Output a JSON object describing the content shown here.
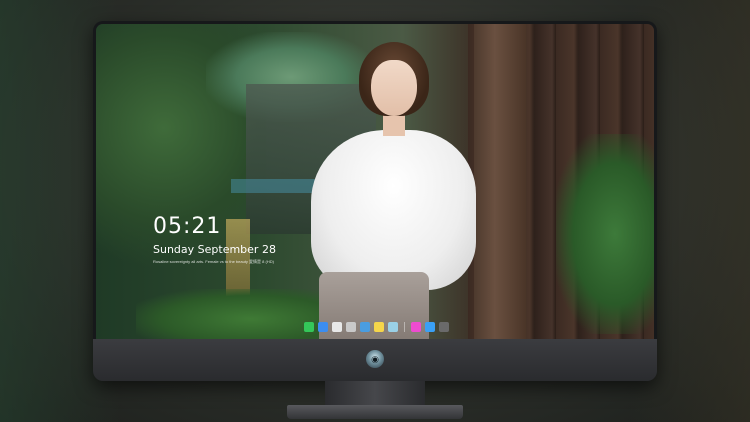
{
  "lockscreen": {
    "time": "05:21",
    "date": "Sunday September  28",
    "caption": "Rosaline sovereignty all arts. Female vs to the beauty 愛情是 8 (HD)"
  },
  "dock": {
    "icons": [
      {
        "name": "messages-icon",
        "color": "#34c759"
      },
      {
        "name": "finder-icon",
        "color": "#3b8df0"
      },
      {
        "name": "safari-icon",
        "color": "#e8e8e8"
      },
      {
        "name": "preview-icon",
        "color": "#c9c9c9"
      },
      {
        "name": "clapper-icon",
        "color": "#4a9de0"
      },
      {
        "name": "notes-icon",
        "color": "#f5d54a"
      },
      {
        "name": "photos-icon",
        "color": "#9ad0e6"
      },
      {
        "name": "itunes-icon",
        "color": "#ee4bd0"
      },
      {
        "name": "appstore-icon",
        "color": "#3aa0f5"
      },
      {
        "name": "camera-icon",
        "color": "#6a6a6a"
      }
    ]
  },
  "colors": {
    "bezel": "#16181a",
    "chin": "#3b3c40",
    "text": "#ffffff"
  }
}
